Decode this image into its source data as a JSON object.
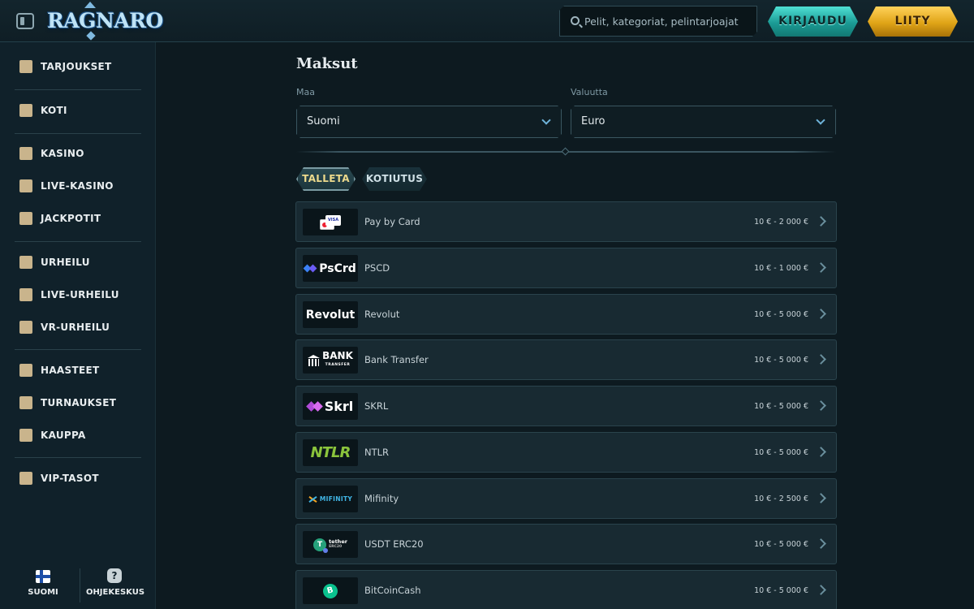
{
  "header": {
    "logo_text": "RAGNARO",
    "search_placeholder": "Pelit, kategoriat, pelintarjoajat",
    "login_label": "KIRJAUDU",
    "join_label": "LIITY"
  },
  "sidebar": {
    "items": [
      {
        "label": "TARJOUKSET",
        "icon": "gift-icon"
      },
      {
        "label": "KOTI",
        "icon": "home-icon"
      },
      {
        "label": "KASINO",
        "icon": "slot-machine-icon"
      },
      {
        "label": "LIVE-KASINO",
        "icon": "playing-card-icon"
      },
      {
        "label": "JACKPOTIT",
        "icon": "clover-icon"
      },
      {
        "label": "URHEILU",
        "icon": "soccer-ball-icon"
      },
      {
        "label": "LIVE-URHEILU",
        "icon": "live-badge-icon"
      },
      {
        "label": "VR-URHEILU",
        "icon": "vr-headset-icon"
      },
      {
        "label": "HAASTEET",
        "icon": "badge-icon"
      },
      {
        "label": "TURNAUKSET",
        "icon": "trophy-icon"
      },
      {
        "label": "KAUPPA",
        "icon": "shop-bag-icon"
      },
      {
        "label": "VIP-TASOT",
        "icon": "diamond-icon"
      }
    ],
    "language_label": "SUOMI",
    "help_label": "OHJEKESKUS"
  },
  "main": {
    "title": "Maksut",
    "country_label": "Maa",
    "country_value": "Suomi",
    "currency_label": "Valuutta",
    "currency_value": "Euro",
    "tabs": [
      {
        "label": "TALLETA",
        "active": true
      },
      {
        "label": "KOTIUTUS",
        "active": false
      }
    ],
    "methods": [
      {
        "name": "Pay by Card",
        "range": "10 € - 2 000 €",
        "logo": "card"
      },
      {
        "name": "PSCD",
        "range": "10 € - 1 000 €",
        "logo": "PsCrd"
      },
      {
        "name": "Revolut",
        "range": "10 € - 5 000 €",
        "logo": "Revolut"
      },
      {
        "name": "Bank Transfer",
        "range": "10 € - 5 000 €",
        "logo": "BANK"
      },
      {
        "name": "SKRL",
        "range": "10 € - 5 000 €",
        "logo": "Skrl"
      },
      {
        "name": "NTLR",
        "range": "10 € - 5 000 €",
        "logo": "NTLR"
      },
      {
        "name": "Mifinity",
        "range": "10 € - 2 500 €",
        "logo": "MIFINITY"
      },
      {
        "name": "USDT ERC20",
        "range": "10 € - 5 000 €",
        "logo": "tether"
      },
      {
        "name": "BitCoinCash",
        "range": "10 € - 5 000 €",
        "logo": "bch"
      }
    ],
    "logo_texts": {
      "card": "VISA",
      "psc": "PsCrd",
      "revolut": "Revolut",
      "bank": "BANK",
      "bank_sub": "TRANSFER",
      "skrl": "Skrl",
      "ntlr": "NTLR",
      "mifinity": "MIFINITY",
      "tether": "tether",
      "tether_sub": "ERC20",
      "tether_symbol": "T",
      "bch_symbol": "B"
    }
  },
  "colors": {
    "background": "#0d1a20",
    "login_button": "#1b9b95",
    "join_button": "#e0a417",
    "active_tab_text": "#ecd98c"
  }
}
